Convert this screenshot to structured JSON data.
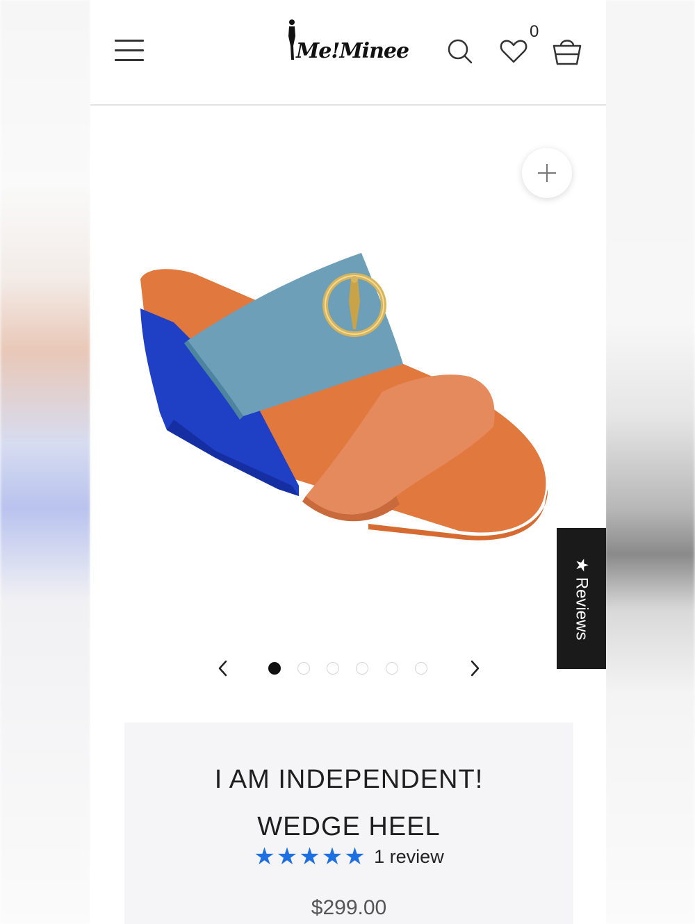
{
  "brand": {
    "logo_text": "Me!Minee"
  },
  "header": {
    "menu_icon": "hamburger-menu-icon",
    "search_icon": "search-icon",
    "wishlist_icon": "heart-icon",
    "wishlist_count": "0",
    "cart_icon": "shopping-bag-icon"
  },
  "gallery": {
    "zoom_icon": "plus-icon",
    "image_alt": "Wedge sandal with light blue suede strap, orange leather strap and royal blue suede wedge",
    "current_slide": 1,
    "total_slides": 6
  },
  "reviews_tab": {
    "label": "★ Reviews"
  },
  "product": {
    "title_line1": "I AM INDEPENDENT!",
    "title_line2": "WEDGE HEEL",
    "stars": "★★★★★",
    "rating": 5,
    "review_count_text": "1 review",
    "price": "$299.00"
  },
  "colors": {
    "accent_star": "#1e6fe0",
    "reviews_tab_bg": "#1a1a1a",
    "info_bg": "#f5f5f7"
  }
}
